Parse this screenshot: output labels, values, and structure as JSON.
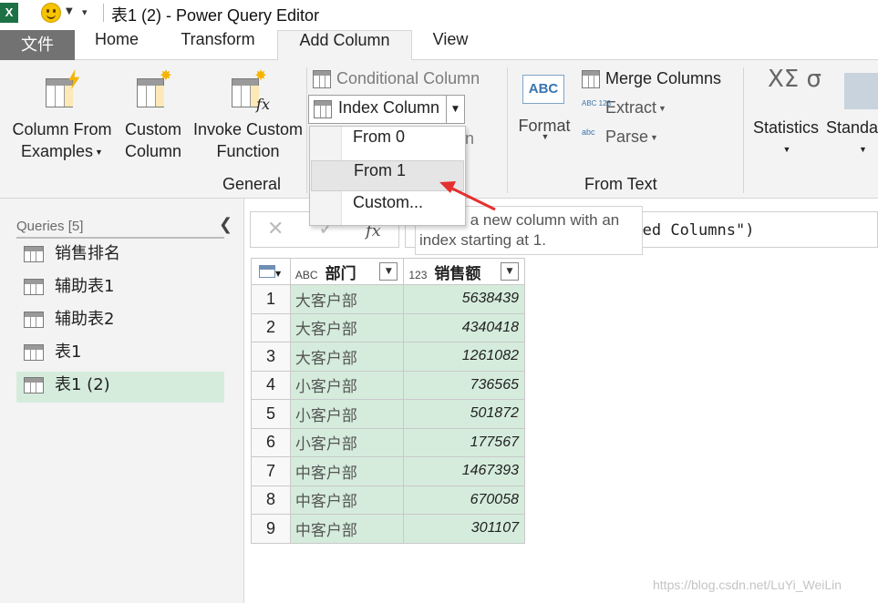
{
  "titlebar": {
    "app_icon": "excel-icon",
    "app_icon_text": "X",
    "title": "表1 (2) - Power Query Editor"
  },
  "tabs": {
    "file": "文件",
    "items": [
      "Home",
      "Transform",
      "Add Column",
      "View"
    ],
    "active": "Add Column"
  },
  "ribbon": {
    "general": {
      "label": "General",
      "column_from_examples_1": "Column From",
      "column_from_examples_2": "Examples",
      "custom_column_1": "Custom",
      "custom_column_2": "Column",
      "invoke_function_1": "Invoke Custom",
      "invoke_function_2": "Function"
    },
    "conditional_column": "Conditional Column",
    "index_column": "Index Column",
    "duplicate_partial": "n",
    "from_text": {
      "label": "From Text",
      "format": "Format",
      "merge_columns": "Merge Columns",
      "extract": "Extract",
      "parse": "Parse",
      "format_icon_text": "ABC",
      "extract_icon_text": "ABC 123",
      "parse_icon_text": "abc"
    },
    "statistics": "Statistics",
    "standard_partial": "Standa",
    "statistics_icon_text": "XΣ σ"
  },
  "index_menu": {
    "items": [
      "From 0",
      "From 1",
      "Custom..."
    ],
    "hovered": "From 1",
    "tooltip": "Create a new column with an index starting at 1."
  },
  "queries": {
    "header": "Queries [5]",
    "items": [
      "销售排名",
      "辅助表1",
      "辅助表2",
      "表1",
      "表1 (2)"
    ],
    "selected": "表1 (2)"
  },
  "formula_bar": {
    "cancel_glyph": "✕",
    "commit_glyph": "✓",
    "fx_label": "fx",
    "formula": "= Table.Distinct(#\"Removed Columns\")"
  },
  "table": {
    "columns": [
      {
        "type": "ABC",
        "name": "部门"
      },
      {
        "type": "123",
        "name": "销售额"
      }
    ],
    "rows": [
      {
        "index": "1",
        "dept": "大客户部",
        "sales": "5638439"
      },
      {
        "index": "2",
        "dept": "大客户部",
        "sales": "4340418"
      },
      {
        "index": "3",
        "dept": "大客户部",
        "sales": "1261082"
      },
      {
        "index": "4",
        "dept": "小客户部",
        "sales": "736565"
      },
      {
        "index": "5",
        "dept": "小客户部",
        "sales": "501872"
      },
      {
        "index": "6",
        "dept": "小客户部",
        "sales": "177567"
      },
      {
        "index": "7",
        "dept": "中客户部",
        "sales": "1467393"
      },
      {
        "index": "8",
        "dept": "中客户部",
        "sales": "670058"
      },
      {
        "index": "9",
        "dept": "中客户部",
        "sales": "301107"
      }
    ]
  },
  "watermark": "https://blog.csdn.net/LuYi_WeiLin",
  "colors": {
    "accent_arrow": "#e53030",
    "selected_bg": "#d5ecdc",
    "file_tab_bg": "#727272"
  }
}
